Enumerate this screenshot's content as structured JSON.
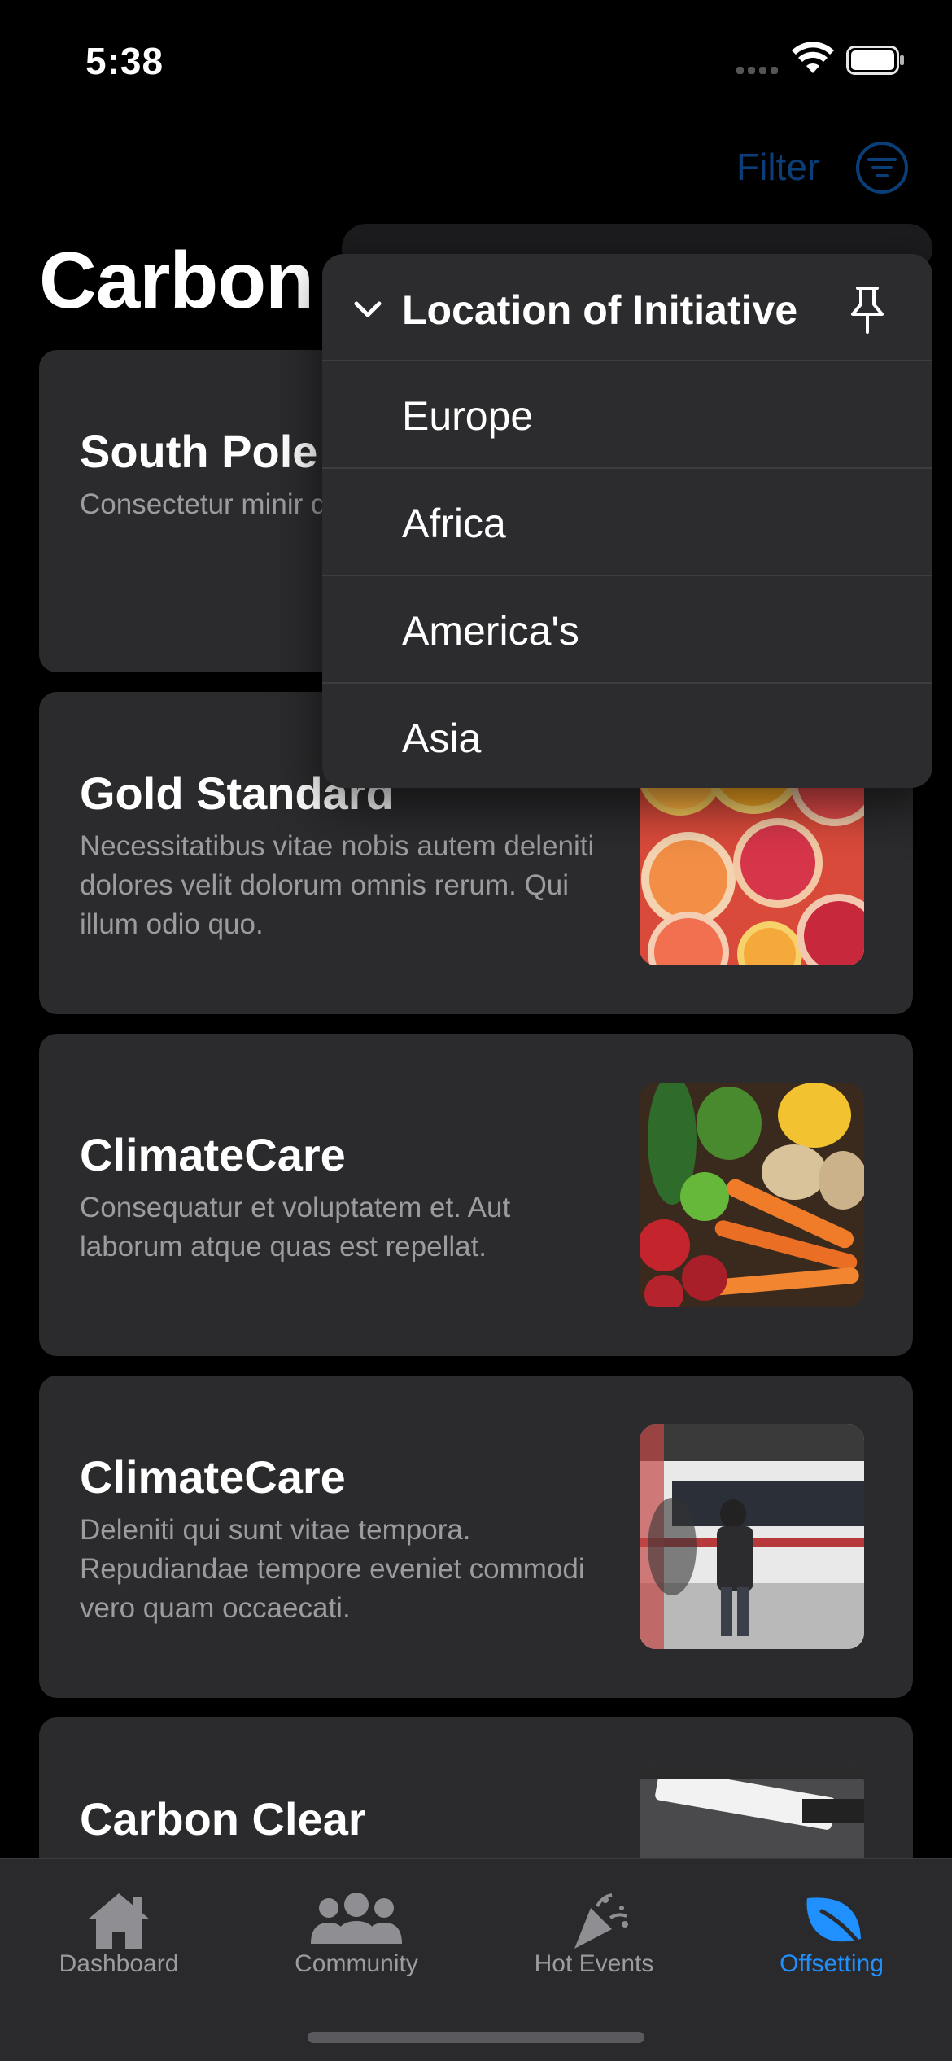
{
  "status": {
    "time": "5:38"
  },
  "header": {
    "filter_label": "Filter",
    "title": "Carbon"
  },
  "cards": [
    {
      "title": "South Pole",
      "description": "Consectetur minir ducimus voluptate inventore illum sap"
    },
    {
      "title": "Gold Standard",
      "description": "Necessitatibus vitae nobis autem deleniti dolores velit dolorum omnis rerum. Qui illum odio quo."
    },
    {
      "title": "ClimateCare",
      "description": "Consequatur et voluptatem et. Aut laborum atque quas est repellat."
    },
    {
      "title": "ClimateCare",
      "description": "Deleniti qui sunt vitae tempora. Repudiandae tempore eveniet commodi vero quam occaecati."
    },
    {
      "title": "Carbon Clear",
      "description": ""
    }
  ],
  "menu": {
    "heading": "Location of Initiative",
    "items": [
      "Europe",
      "Africa",
      "America's",
      "Asia"
    ]
  },
  "tabbar": {
    "tabs": [
      {
        "label": "Dashboard",
        "icon": "house-icon"
      },
      {
        "label": "Community",
        "icon": "people-icon"
      },
      {
        "label": "Hot Events",
        "icon": "party-popper-icon"
      },
      {
        "label": "Offsetting",
        "icon": "leaf-icon"
      }
    ],
    "active": "Offsetting",
    "accent": "#2090ff"
  }
}
